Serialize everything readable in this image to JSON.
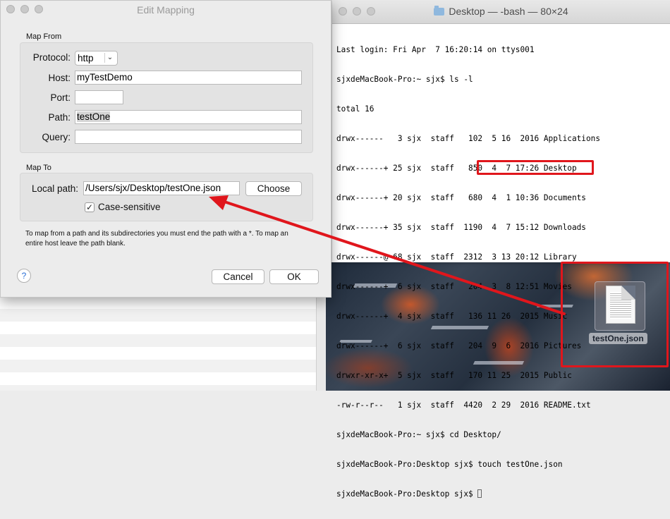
{
  "dialog": {
    "title": "Edit Mapping",
    "map_from": {
      "section_label": "Map From",
      "protocol_label": "Protocol:",
      "protocol_value": "http",
      "host_label": "Host:",
      "host_value": "myTestDemo",
      "port_label": "Port:",
      "port_value": "",
      "path_label": "Path:",
      "path_value": "testOne",
      "query_label": "Query:",
      "query_value": ""
    },
    "map_to": {
      "section_label": "Map To",
      "local_path_label": "Local path:",
      "local_path_value": "/Users/sjx/Desktop/testOne.json",
      "choose_label": "Choose",
      "case_sensitive_label": "Case-sensitive",
      "case_sensitive_checked": true
    },
    "help_text": "To map from a path and its subdirectories you must end the path with a *. To map an entire host leave the path blank.",
    "help_glyph": "?",
    "cancel_label": "Cancel",
    "ok_label": "OK"
  },
  "terminal": {
    "title": "Desktop — -bash — 80×24",
    "lines": [
      "Last login: Fri Apr  7 16:20:14 on ttys001",
      "sjxdeMacBook-Pro:~ sjx$ ls -l",
      "total 16",
      "drwx------   3 sjx  staff   102  5 16  2016 Applications",
      "drwx------+ 25 sjx  staff   850  4  7 17:26 Desktop",
      "drwx------+ 20 sjx  staff   680  4  1 10:36 Documents",
      "drwx------+ 35 sjx  staff  1190  4  7 15:12 Downloads",
      "drwx------@ 68 sjx  staff  2312  3 13 20:12 Library",
      "drwx------+  6 sjx  staff   204  3  8 12:51 Movies",
      "drwx------+  4 sjx  staff   136 11 26  2015 Music",
      "drwx------+  6 sjx  staff   204  9  6  2016 Pictures",
      "drwxr-xr-x+  5 sjx  staff   170 11 25  2015 Public",
      "-rw-r--r--   1 sjx  staff  4420  2 29  2016 README.txt",
      "sjxdeMacBook-Pro:~ sjx$ cd Desktop/",
      "sjxdeMacBook-Pro:Desktop sjx$ touch testOne.json",
      "sjxdeMacBook-Pro:Desktop sjx$ "
    ]
  },
  "desktop": {
    "file_name": "testOne.json"
  },
  "colors": {
    "annotation_red": "#e0161c"
  }
}
